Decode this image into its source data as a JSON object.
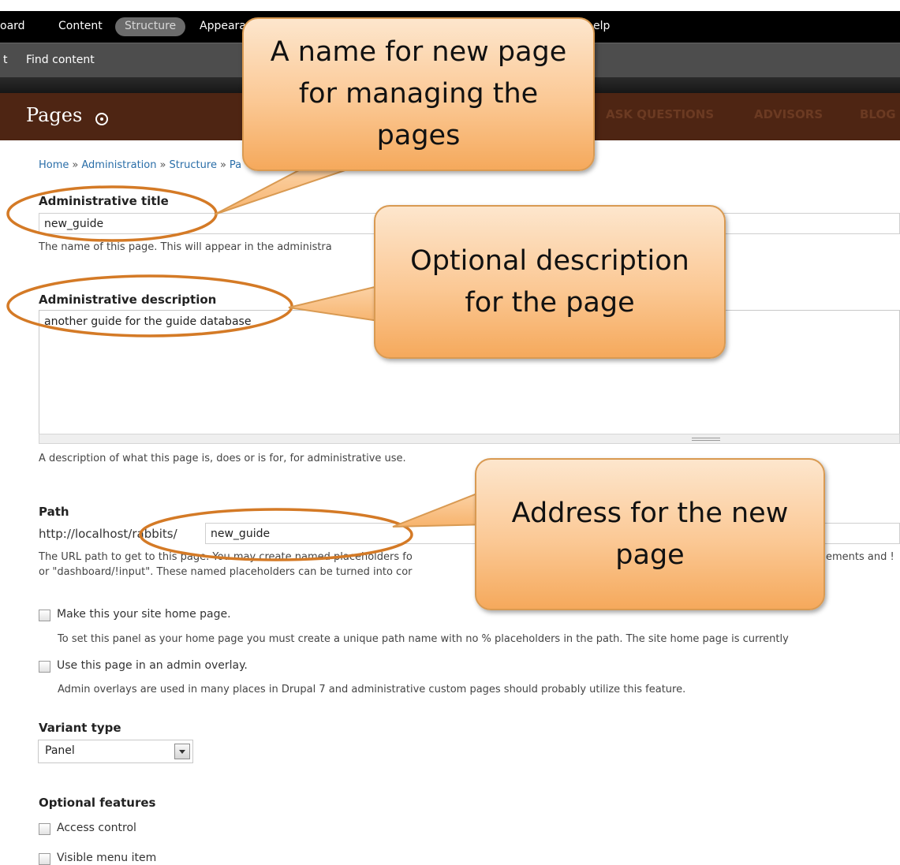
{
  "toolbar": {
    "items": [
      "oard",
      "Content",
      "Structure",
      "Appeara",
      "elp"
    ]
  },
  "shortcuts": {
    "prefix": "t",
    "find_content": "Find content"
  },
  "header": {
    "title": "Pages",
    "nav": [
      "ASK QUESTIONS",
      "ADVISORS",
      "BLOG"
    ]
  },
  "breadcrumb": {
    "items": [
      "Home",
      "Administration",
      "Structure",
      "Pa"
    ],
    "separator": "»"
  },
  "form": {
    "admin_title": {
      "label": "Administrative title",
      "value": "new_guide",
      "help": "The name of this page. This will appear in the administra"
    },
    "admin_description": {
      "label": "Administrative description",
      "value": "another guide for the guide database",
      "help": "A description of what this page is, does or is for, for administrative use."
    },
    "path": {
      "label": "Path",
      "prefix": "http://localhost/rabbits/",
      "value": "new_guide",
      "help_line1": "The URL path to get to this page. You may create named placeholders fo",
      "help_line1_end": "ements and !",
      "help_line2": "or \"dashboard/!input\". These named placeholders can be turned into cor"
    },
    "home_page": {
      "label": "Make this your site home page.",
      "help": "To set this panel as your home page you must create a unique path name with no % placeholders in the path. The site home page is currently"
    },
    "admin_overlay": {
      "label": "Use this page in an admin overlay.",
      "help": "Admin overlays are used in many places in Drupal 7 and administrative custom pages should probably utilize this feature."
    },
    "variant_type": {
      "label": "Variant type",
      "selected": "Panel"
    },
    "optional_features": {
      "label": "Optional features",
      "options": [
        "Access control",
        "Visible menu item"
      ]
    }
  },
  "callouts": {
    "name": [
      "A name for new page",
      "for managing the",
      "pages"
    ],
    "description": [
      "Optional description",
      "for the page"
    ],
    "address": [
      "Address for the new",
      "page"
    ]
  },
  "colors": {
    "toolbar": "#000000",
    "header": "#4e2513",
    "link": "#2a6ea8",
    "callout": "#fbc894",
    "annotation_ring": "#d47a26"
  }
}
